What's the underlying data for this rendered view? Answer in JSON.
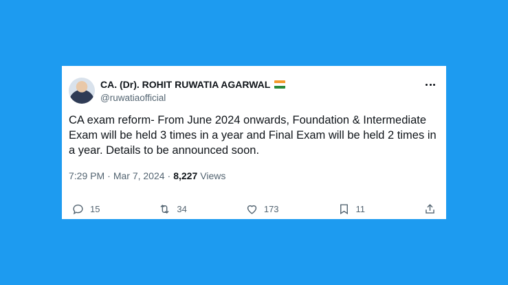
{
  "author": {
    "name": "CA. (Dr). ROHIT RUWATIA AGARWAL",
    "handle": "@ruwatiaofficial",
    "badge_icon": "india-flag-icon"
  },
  "tweet": {
    "text": "CA exam reform- From June 2024 onwards, Foundation & Intermediate Exam will be held 3 times in a year and Final Exam will be held 2 times in a year. Details to be announced soon.",
    "time": "7:29 PM",
    "separator": "·",
    "date": "Mar 7, 2024",
    "views_count": "8,227",
    "views_label": "Views"
  },
  "actions": {
    "replies": "15",
    "reposts": "34",
    "likes": "173",
    "bookmarks": "11"
  },
  "colors": {
    "background": "#1d9bf0",
    "text_primary": "#0f1419",
    "text_secondary": "#536471"
  }
}
